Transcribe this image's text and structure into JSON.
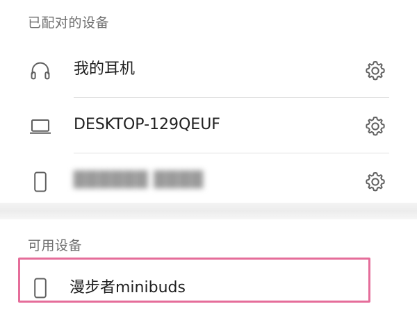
{
  "sections": {
    "paired_title": "已配对的设备",
    "available_title": "可用设备"
  },
  "paired_devices": [
    {
      "name": "我的耳机",
      "icon": "headphones-icon"
    },
    {
      "name": "DESKTOP-129QEUF",
      "icon": "laptop-icon"
    },
    {
      "name": "██████ ████",
      "icon": "phone-icon",
      "obscured": true
    }
  ],
  "available_devices": [
    {
      "name": "漫步者minibuds",
      "icon": "phone-icon"
    }
  ],
  "colors": {
    "highlight_border": "#e56d9a",
    "section_text": "#6f6f6f",
    "divider": "#e2e2e2",
    "icon": "#5f5f5f"
  }
}
